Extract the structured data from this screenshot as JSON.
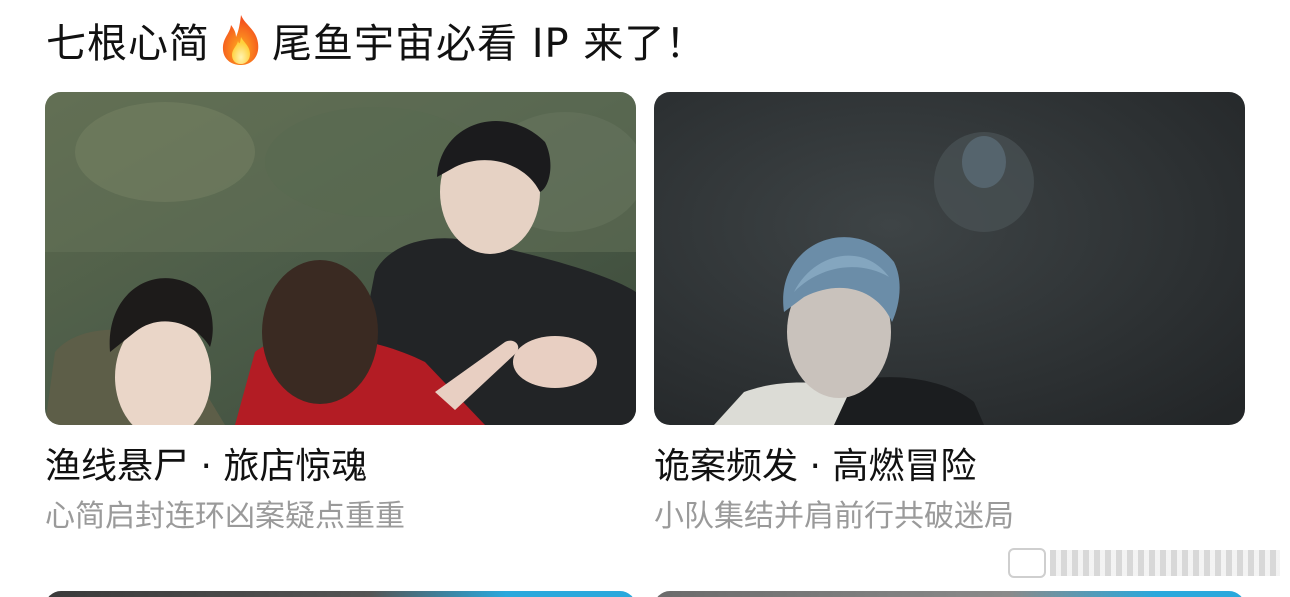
{
  "header": {
    "title_part1": "七根心简",
    "icon": "fire-icon",
    "title_part2": "尾鱼宇宙必看 IP 来了！"
  },
  "cards": [
    {
      "title": "渔线悬尸 · 旅店惊魂",
      "subtitle": "心简启封连环凶案疑点重重"
    },
    {
      "title": "诡案频发 · 高燃冒险",
      "subtitle": "小队集结并肩前行共破迷局"
    }
  ],
  "colors": {
    "title_text": "#111111",
    "subtitle_text": "#9a9a9a",
    "fire_orange": "#ff6a1a",
    "fire_yellow": "#ffd23c"
  }
}
